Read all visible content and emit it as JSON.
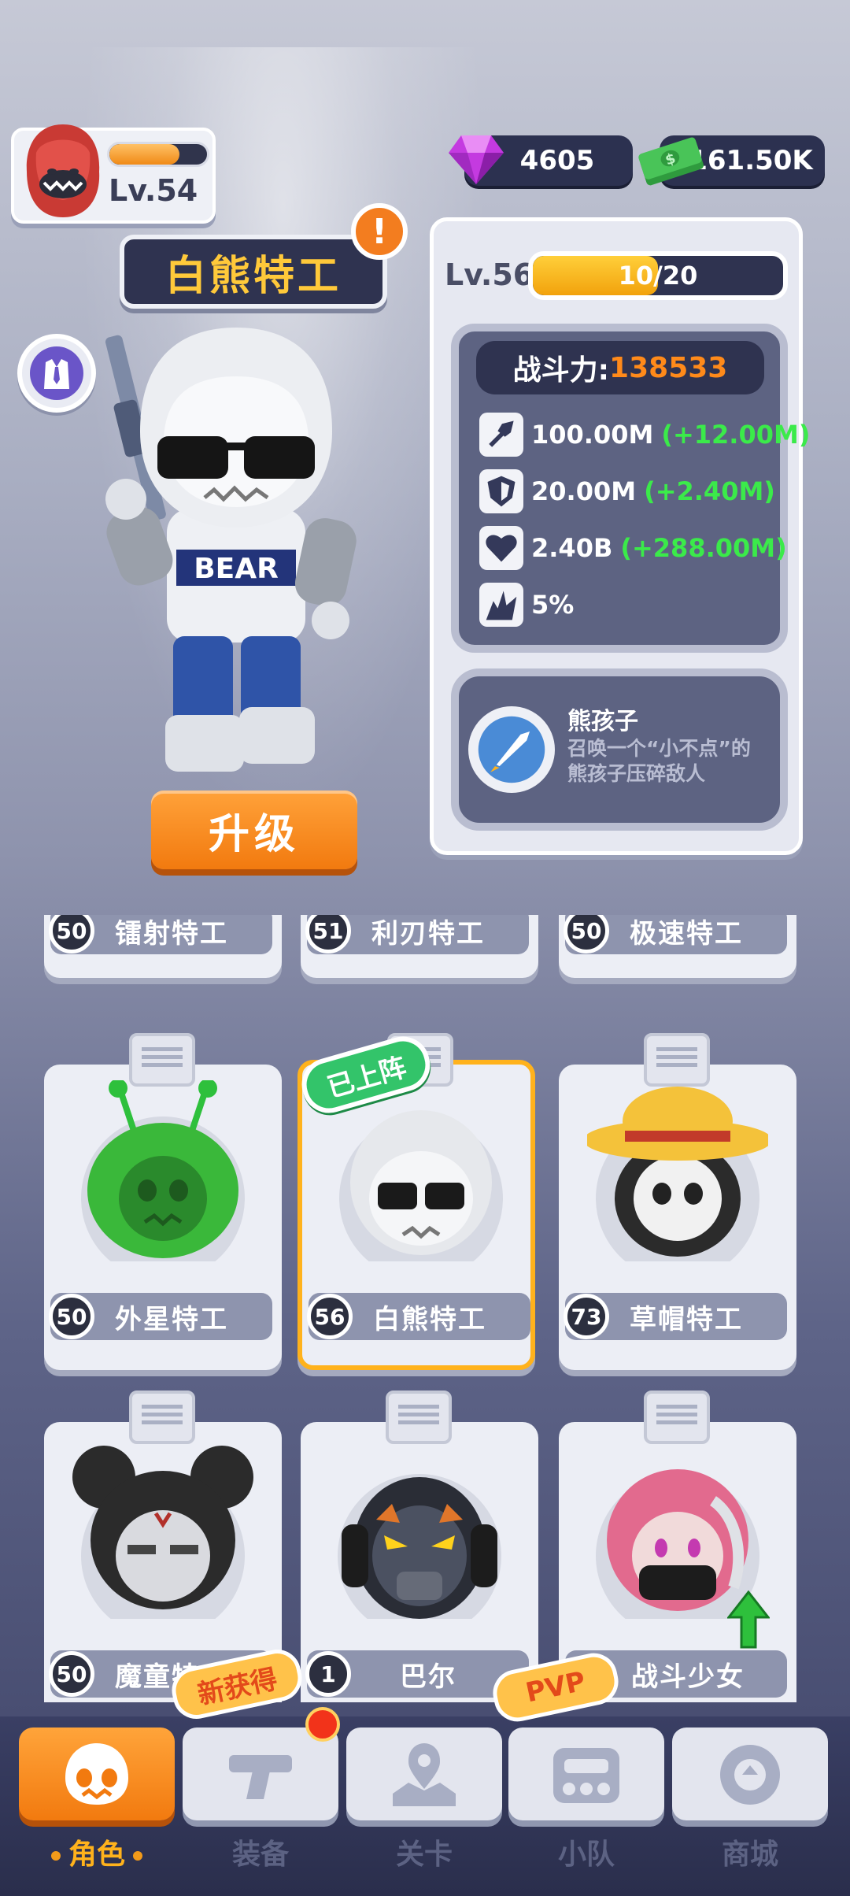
{
  "player": {
    "level": "Lv.54",
    "xp_fraction": 0.72
  },
  "currency": {
    "gems": "4605",
    "cash": "161.50K"
  },
  "hero": {
    "name": "白熊特工",
    "upgrade_label": "升级"
  },
  "stats": {
    "level": "Lv.56",
    "progress_text": "10/20",
    "progress_fraction": 0.5,
    "power_label": "战斗力:",
    "power_value": "138533",
    "rows": [
      {
        "icon": "shovel-icon",
        "value": "100.00M",
        "bonus": "(+12.00M)"
      },
      {
        "icon": "shield-icon",
        "value": "20.00M",
        "bonus": "(+2.40M)"
      },
      {
        "icon": "heart-icon",
        "value": "2.40B",
        "bonus": "(+288.00M)"
      },
      {
        "icon": "crit-icon",
        "value": "5%",
        "bonus": ""
      }
    ],
    "skill": {
      "name": "熊孩子",
      "desc": "召唤一个“小不点”的熊孩子压碎敌人"
    }
  },
  "characters": {
    "row0": [
      {
        "level": "50",
        "name": "镭射特工"
      },
      {
        "level": "51",
        "name": "利刃特工"
      },
      {
        "level": "50",
        "name": "极速特工"
      }
    ],
    "row1": [
      {
        "level": "50",
        "name": "外星特工"
      },
      {
        "level": "56",
        "name": "白熊特工"
      },
      {
        "level": "73",
        "name": "草帽特工"
      }
    ],
    "row2": [
      {
        "level": "50",
        "name": "魔童特工"
      },
      {
        "level": "1",
        "name": "巴尔"
      },
      {
        "level": "",
        "name": "战斗少女"
      }
    ],
    "equipped_label": "已上阵"
  },
  "nav": {
    "tabs": [
      {
        "label": "角色",
        "icon": "skull-icon"
      },
      {
        "label": "装备",
        "icon": "gun-icon"
      },
      {
        "label": "关卡",
        "icon": "map-pin-icon"
      },
      {
        "label": "小队",
        "icon": "team-icon"
      },
      {
        "label": "商城",
        "icon": "shop-icon"
      }
    ],
    "new_badge": "新获得",
    "pvp_badge": "PVP"
  },
  "colors": {
    "accent": "#f27a0f",
    "panel": "#2f3350",
    "bonus": "#3bea4a",
    "power": "#ff8a1a"
  }
}
